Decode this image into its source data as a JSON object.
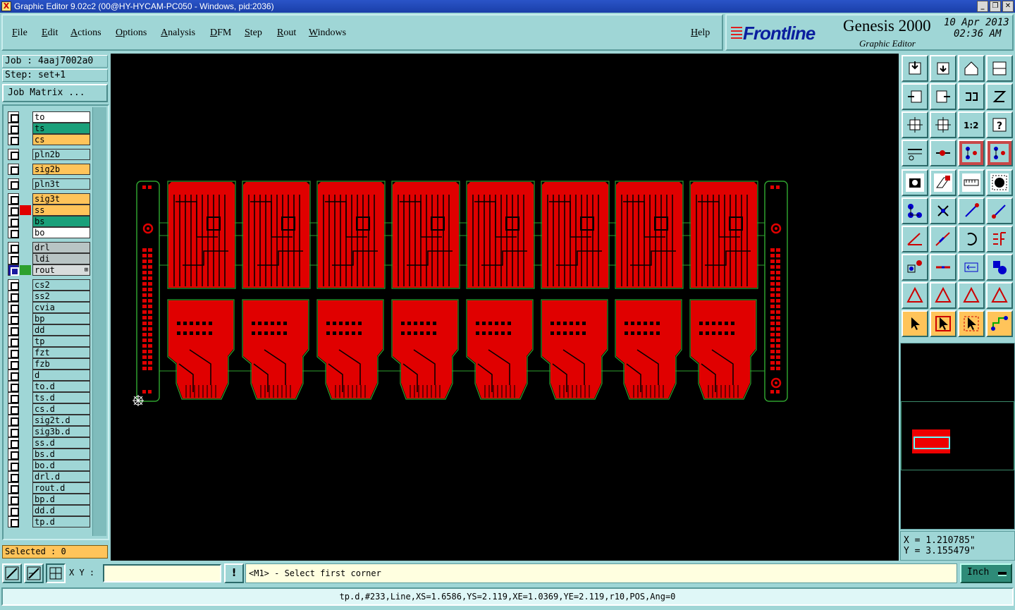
{
  "window": {
    "title": "Graphic Editor 9.02c2 (00@HY-HYCAM-PC050 - Windows, pid:2036)",
    "app_icon_glyph": "X",
    "btn_minimize": "_",
    "btn_restore": "❐",
    "btn_close": "✕"
  },
  "menu": {
    "file": "File",
    "edit": "Edit",
    "actions": "Actions",
    "options": "Options",
    "analysis": "Analysis",
    "dfm": "DFM",
    "step": "Step",
    "rout": "Rout",
    "windows": "Windows",
    "help": "Help"
  },
  "brand": {
    "logo": "Frontline",
    "product": "Genesis 2000",
    "subtitle": "Graphic Editor",
    "date": "10 Apr 2013",
    "time": "02:36 AM"
  },
  "job": {
    "job_line": "Job : 4aaj7002a0",
    "step_line": "Step: set+1",
    "job_matrix_label": "Job Matrix ..."
  },
  "layers": [
    {
      "name": "to",
      "color": "#ffffff",
      "swatch": ""
    },
    {
      "name": "ts",
      "color": "#1aa07a",
      "swatch": ""
    },
    {
      "name": "cs",
      "color": "#ffc45a",
      "swatch": ""
    },
    {
      "name": "pln2b",
      "color": "#9fd6d6",
      "swatch": ""
    },
    {
      "name": "sig2b",
      "color": "#ffc45a",
      "swatch": ""
    },
    {
      "name": "pln3t",
      "color": "#9fd6d6",
      "swatch": ""
    },
    {
      "name": "sig3t",
      "color": "#ffc45a",
      "swatch": ""
    },
    {
      "name": "ss",
      "color": "#ffc45a",
      "swatch": "#e00000"
    },
    {
      "name": "bs",
      "color": "#1aa07a",
      "swatch": ""
    },
    {
      "name": "bo",
      "color": "#ffffff",
      "swatch": ""
    },
    {
      "name": "drl",
      "color": "#b8c4c4",
      "swatch": ""
    },
    {
      "name": "ldi",
      "color": "#b8c4c4",
      "swatch": ""
    },
    {
      "name": "rout",
      "color": "#d8dcdc",
      "swatch": "#2ea02e",
      "active": true
    },
    {
      "name": "cs2",
      "color": "#9fd6d6",
      "swatch": ""
    },
    {
      "name": "ss2",
      "color": "#9fd6d6",
      "swatch": ""
    },
    {
      "name": "cvia",
      "color": "#9fd6d6",
      "swatch": ""
    },
    {
      "name": "bp",
      "color": "#9fd6d6",
      "swatch": ""
    },
    {
      "name": "dd",
      "color": "#9fd6d6",
      "swatch": ""
    },
    {
      "name": "tp",
      "color": "#9fd6d6",
      "swatch": ""
    },
    {
      "name": "fzt",
      "color": "#9fd6d6",
      "swatch": ""
    },
    {
      "name": "fzb",
      "color": "#9fd6d6",
      "swatch": ""
    },
    {
      "name": "d",
      "color": "#9fd6d6",
      "swatch": ""
    },
    {
      "name": "to.d",
      "color": "#9fd6d6",
      "swatch": ""
    },
    {
      "name": "ts.d",
      "color": "#9fd6d6",
      "swatch": ""
    },
    {
      "name": "cs.d",
      "color": "#9fd6d6",
      "swatch": ""
    },
    {
      "name": "sig2t.d",
      "color": "#9fd6d6",
      "swatch": ""
    },
    {
      "name": "sig3b.d",
      "color": "#9fd6d6",
      "swatch": ""
    },
    {
      "name": "ss.d",
      "color": "#9fd6d6",
      "swatch": ""
    },
    {
      "name": "bs.d",
      "color": "#9fd6d6",
      "swatch": ""
    },
    {
      "name": "bo.d",
      "color": "#9fd6d6",
      "swatch": ""
    },
    {
      "name": "drl.d",
      "color": "#9fd6d6",
      "swatch": ""
    },
    {
      "name": "rout.d",
      "color": "#9fd6d6",
      "swatch": ""
    },
    {
      "name": "bp.d",
      "color": "#9fd6d6",
      "swatch": ""
    },
    {
      "name": "dd.d",
      "color": "#9fd6d6",
      "swatch": ""
    },
    {
      "name": "tp.d",
      "color": "#9fd6d6",
      "swatch": ""
    }
  ],
  "selected": "Selected : 0",
  "coords": {
    "x": "X = 1.210785\"",
    "y": "Y = 3.155479\""
  },
  "command": {
    "xy_label": "X Y :",
    "xy_value": "",
    "alert_glyph": "!",
    "prompt": "<M1> - Select first corner",
    "units": "Inch"
  },
  "status": "tp.d,#233,Line,XS=1.6586,YS=2.119,XE=1.0369,YE=2.119,r10,POS,Ang=0",
  "colors": {
    "copper": "#e00000",
    "outline": "#2ea02e",
    "background": "#000000",
    "panel": "#9fd6d6"
  },
  "tools": [
    "zoom-home-icon",
    "zoom-step-icon",
    "home-icon",
    "window-icon",
    "pan-left-icon",
    "pan-right-icon",
    "flip-icon",
    "redraw-icon",
    "fit-icon",
    "center-icon",
    "scale-1-2-icon",
    "help-icon",
    "tools-icon",
    "probe-icon",
    "snap-icon",
    "snap-toggle-icon",
    "camera-icon",
    "draw-icon",
    "measure-icon",
    "fill-icon",
    "node-icon",
    "cross-icon",
    "connect-icon",
    "connect-alt-icon",
    "angle-icon",
    "line-icon",
    "arc-icon",
    "split-icon",
    "select-node-icon",
    "cut-icon",
    "dimension-icon",
    "shape-icon",
    "triangle-icon",
    "triangle-alt-icon",
    "triangle-red-icon",
    "triangle-cross-icon",
    "pointer-icon",
    "pointer-box-icon",
    "pointer-area-icon",
    "route-icon"
  ]
}
